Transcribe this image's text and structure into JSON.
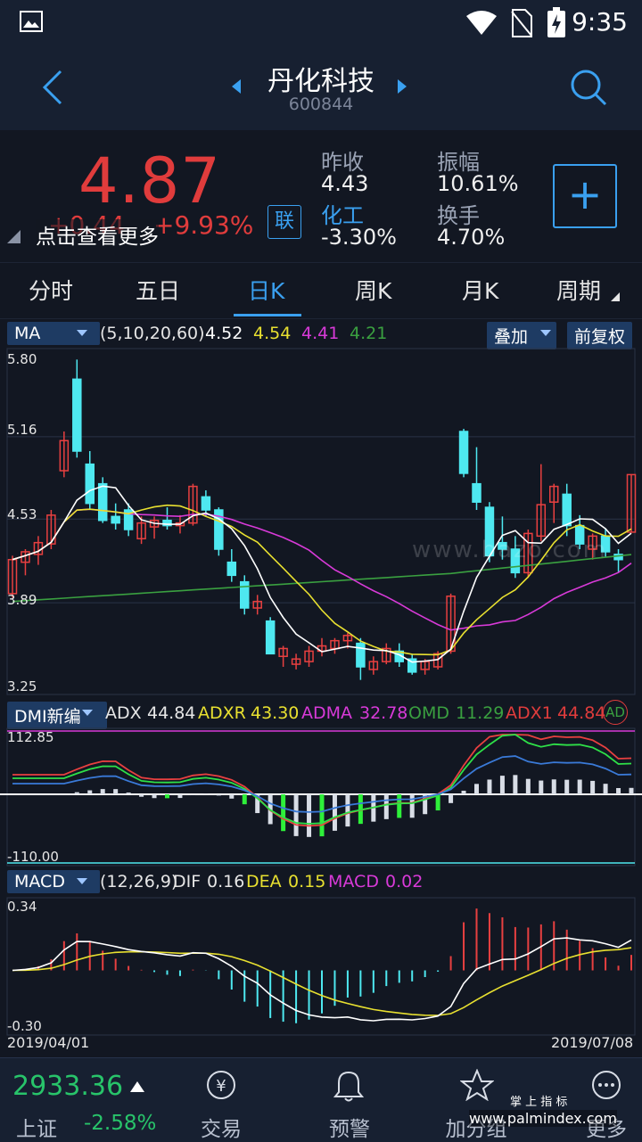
{
  "status": {
    "time": "9:35"
  },
  "header": {
    "title": "丹化科技",
    "code": "600844"
  },
  "quote": {
    "price": "4.87",
    "change": "+0.44",
    "change_pct": "+9.93%",
    "hint": "点击查看更多",
    "link_badge": "联",
    "prev_close_label": "昨收",
    "prev_close": "4.43",
    "sector_label": "化工",
    "sector_change": "-3.30%",
    "amplitude_label": "振幅",
    "amplitude": "10.61%",
    "turnover_label": "换手",
    "turnover": "4.70%",
    "add_label": "+"
  },
  "tabs": [
    {
      "label": "分时"
    },
    {
      "label": "五日"
    },
    {
      "label": "日K"
    },
    {
      "label": "周K"
    },
    {
      "label": "月K"
    },
    {
      "label": "周期"
    }
  ],
  "ma_bar": {
    "indicator": "MA",
    "params": "(5,10,20,60)",
    "v1": "4.52",
    "v2": "4.54",
    "v3": "4.41",
    "v4": "4.21",
    "overlay": "叠加",
    "adjust": "前复权",
    "colors": {
      "ma5": "#ffffff",
      "ma10": "#e8e030",
      "ma20": "#d83ad8",
      "ma60": "#3aa040"
    }
  },
  "price_axis": [
    "5.80",
    "5.16",
    "4.53",
    "3.89",
    "3.25"
  ],
  "dmi_bar": {
    "indicator": "DMI新编",
    "adx_label": "ADX",
    "adx": "44.84",
    "adxr_label": "ADXR",
    "adxr": "43.30",
    "adma_label": "ADMA",
    "adma": "32.78",
    "omd_label": "OMD",
    "omd": "11.29",
    "adx1_label": "ADX1",
    "adx1": "44.84",
    "ad_label": "AD",
    "top": "112.85",
    "bottom": "-110.00"
  },
  "macd_bar": {
    "indicator": "MACD",
    "params": "(12,26,9)",
    "dif_label": "DIF",
    "dif": "0.16",
    "dea_label": "DEA",
    "dea": "0.15",
    "macd_label": "MACD",
    "macd": "0.02",
    "top": "0.34",
    "bottom": "-0.30"
  },
  "dates": {
    "start": "2019/04/01",
    "end": "2019/07/08"
  },
  "watermark": "www.bazo.com",
  "footer": {
    "index_value": "2933.36",
    "index_name": "上证",
    "index_change": "-2.58%",
    "trade": "交易",
    "alert": "预警",
    "watchlist": "加分组",
    "more": "更多",
    "brand": "掌 上 指 标",
    "brand_url": "www.palmindex.com"
  },
  "chart_data": {
    "type": "candlestick",
    "x_range": [
      "2019/04/01",
      "2019/07/08"
    ],
    "ylim": [
      3.25,
      5.8
    ],
    "candles": [
      {
        "o": 3.96,
        "h": 4.25,
        "l": 3.93,
        "c": 4.22
      },
      {
        "o": 4.2,
        "h": 4.3,
        "l": 4.1,
        "c": 4.28
      },
      {
        "o": 4.26,
        "h": 4.4,
        "l": 4.18,
        "c": 4.35
      },
      {
        "o": 4.34,
        "h": 4.6,
        "l": 4.3,
        "c": 4.56
      },
      {
        "o": 4.9,
        "h": 5.2,
        "l": 4.85,
        "c": 5.13
      },
      {
        "o": 5.6,
        "h": 5.75,
        "l": 5.0,
        "c": 5.05
      },
      {
        "o": 4.95,
        "h": 5.05,
        "l": 4.6,
        "c": 4.65
      },
      {
        "o": 4.8,
        "h": 4.85,
        "l": 4.5,
        "c": 4.52
      },
      {
        "o": 4.55,
        "h": 4.65,
        "l": 4.45,
        "c": 4.5
      },
      {
        "o": 4.6,
        "h": 4.65,
        "l": 4.4,
        "c": 4.45
      },
      {
        "o": 4.38,
        "h": 4.55,
        "l": 4.34,
        "c": 4.5
      },
      {
        "o": 4.47,
        "h": 4.55,
        "l": 4.38,
        "c": 4.52
      },
      {
        "o": 4.52,
        "h": 4.62,
        "l": 4.45,
        "c": 4.48
      },
      {
        "o": 4.48,
        "h": 4.56,
        "l": 4.42,
        "c": 4.5
      },
      {
        "o": 4.5,
        "h": 4.8,
        "l": 4.48,
        "c": 4.78
      },
      {
        "o": 4.7,
        "h": 4.75,
        "l": 4.55,
        "c": 4.6
      },
      {
        "o": 4.6,
        "h": 4.62,
        "l": 4.25,
        "c": 4.3
      },
      {
        "o": 4.2,
        "h": 4.3,
        "l": 4.05,
        "c": 4.1
      },
      {
        "o": 4.05,
        "h": 4.1,
        "l": 3.8,
        "c": 3.85
      },
      {
        "o": 3.85,
        "h": 3.95,
        "l": 3.8,
        "c": 3.9
      },
      {
        "o": 3.75,
        "h": 3.78,
        "l": 3.5,
        "c": 3.5
      },
      {
        "o": 3.48,
        "h": 3.56,
        "l": 3.4,
        "c": 3.54
      },
      {
        "o": 3.42,
        "h": 3.5,
        "l": 3.38,
        "c": 3.46
      },
      {
        "o": 3.44,
        "h": 3.56,
        "l": 3.4,
        "c": 3.52
      },
      {
        "o": 3.52,
        "h": 3.62,
        "l": 3.48,
        "c": 3.56
      },
      {
        "o": 3.54,
        "h": 3.62,
        "l": 3.5,
        "c": 3.6
      },
      {
        "o": 3.6,
        "h": 3.66,
        "l": 3.54,
        "c": 3.64
      },
      {
        "o": 3.58,
        "h": 3.62,
        "l": 3.3,
        "c": 3.4
      },
      {
        "o": 3.38,
        "h": 3.48,
        "l": 3.34,
        "c": 3.44
      },
      {
        "o": 3.44,
        "h": 3.58,
        "l": 3.42,
        "c": 3.54
      },
      {
        "o": 3.52,
        "h": 3.58,
        "l": 3.4,
        "c": 3.44
      },
      {
        "o": 3.46,
        "h": 3.5,
        "l": 3.34,
        "c": 3.36
      },
      {
        "o": 3.38,
        "h": 3.46,
        "l": 3.34,
        "c": 3.44
      },
      {
        "o": 3.4,
        "h": 3.52,
        "l": 3.38,
        "c": 3.5
      },
      {
        "o": 3.52,
        "h": 3.96,
        "l": 3.5,
        "c": 3.94
      },
      {
        "o": 5.2,
        "h": 5.22,
        "l": 4.85,
        "c": 4.88
      },
      {
        "o": 4.8,
        "h": 5.08,
        "l": 4.6,
        "c": 4.66
      },
      {
        "o": 4.62,
        "h": 4.66,
        "l": 4.2,
        "c": 4.25
      },
      {
        "o": 4.35,
        "h": 4.55,
        "l": 4.22,
        "c": 4.3
      },
      {
        "o": 4.3,
        "h": 4.4,
        "l": 4.08,
        "c": 4.12
      },
      {
        "o": 4.12,
        "h": 4.45,
        "l": 4.08,
        "c": 4.42
      },
      {
        "o": 4.4,
        "h": 4.95,
        "l": 4.36,
        "c": 4.64
      },
      {
        "o": 4.66,
        "h": 4.8,
        "l": 4.5,
        "c": 4.78
      },
      {
        "o": 4.72,
        "h": 4.8,
        "l": 4.4,
        "c": 4.48
      },
      {
        "o": 4.48,
        "h": 4.56,
        "l": 4.3,
        "c": 4.34
      },
      {
        "o": 4.3,
        "h": 4.42,
        "l": 4.22,
        "c": 4.4
      },
      {
        "o": 4.4,
        "h": 4.46,
        "l": 4.24,
        "c": 4.28
      },
      {
        "o": 4.26,
        "h": 4.3,
        "l": 4.12,
        "c": 4.22
      },
      {
        "o": 4.43,
        "h": 4.87,
        "l": 4.43,
        "c": 4.87
      }
    ]
  }
}
